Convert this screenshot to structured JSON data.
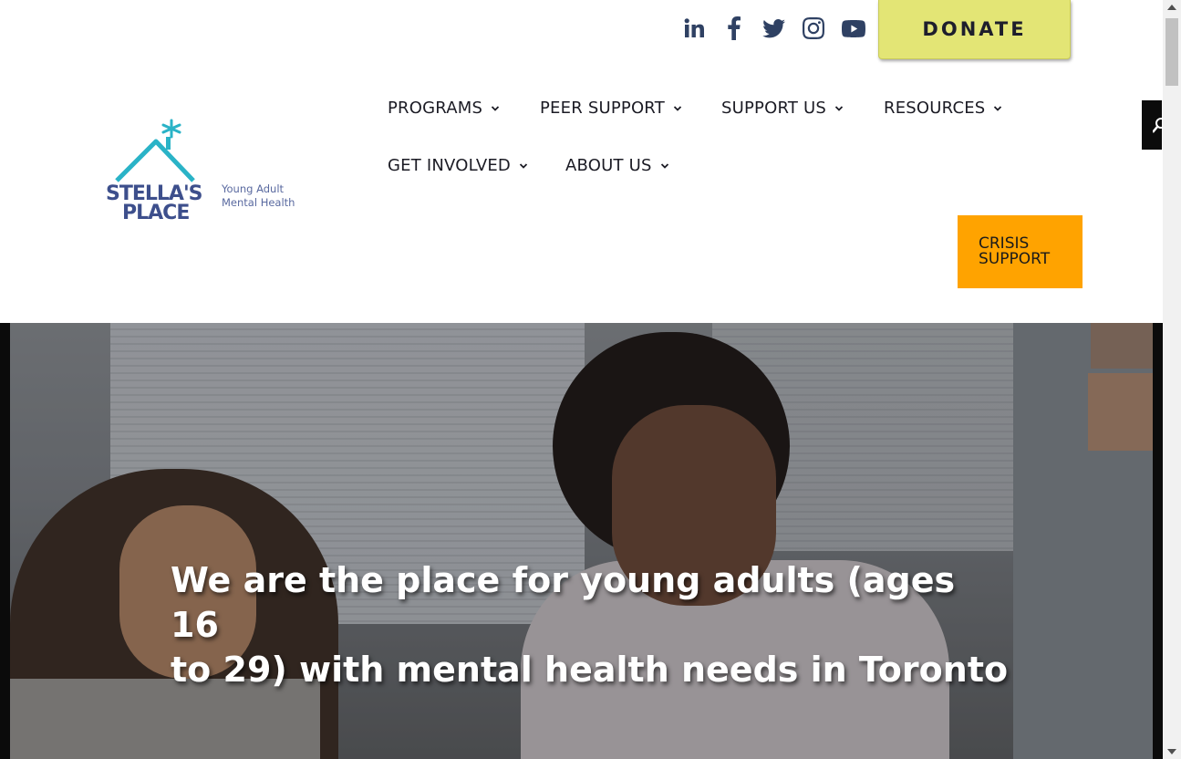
{
  "social": {
    "icons": [
      "linkedin-icon",
      "facebook-icon",
      "twitter-icon",
      "instagram-icon",
      "youtube-icon"
    ]
  },
  "header": {
    "donate_label": "DONATE",
    "logo_tagline_line1": "Young Adult",
    "logo_tagline_line2": "Mental Health",
    "crisis_line1": "CRISIS",
    "crisis_line2": "SUPPORT"
  },
  "nav": {
    "items": [
      {
        "label": "PROGRAMS"
      },
      {
        "label": "PEER SUPPORT"
      },
      {
        "label": "SUPPORT US"
      },
      {
        "label": "RESOURCES"
      },
      {
        "label": "GET INVOLVED"
      },
      {
        "label": "ABOUT US"
      }
    ]
  },
  "hero": {
    "title_line1": "We are the place for young adults (ages 16",
    "title_line2": "to 29) with mental health needs in Toronto"
  },
  "colors": {
    "donate_bg": "#e3e575",
    "crisis_bg": "#ffa300",
    "brand_navy": "#2f4163",
    "logo_teal": "#2ab3c7",
    "logo_blue": "#3d4f8c"
  }
}
